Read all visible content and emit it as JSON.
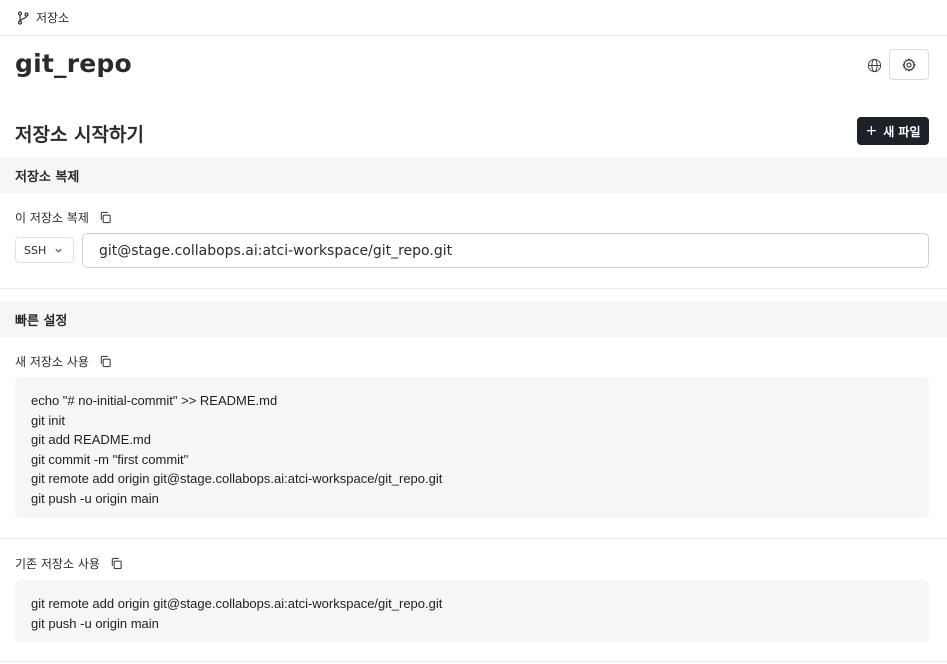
{
  "breadcrumb": {
    "label": "저장소"
  },
  "repo": {
    "name": "git_repo"
  },
  "start": {
    "heading": "저장소 시작하기",
    "new_file_label": "새 파일",
    "new_file_plus": "+"
  },
  "clone": {
    "band_title": "저장소 복제",
    "field_label": "이 저장소 복제",
    "protocol": "SSH",
    "url": "git@stage.collabops.ai:atci-workspace/git_repo.git"
  },
  "quick": {
    "band_title": "빠른 설정",
    "new_repo": {
      "label": "새 저장소 사용",
      "lines": [
        "echo \"# no-initial-commit\" >> README.md",
        "git init",
        "git add README.md",
        "git commit -m \"first commit\"",
        "git remote add origin git@stage.collabops.ai:atci-workspace/git_repo.git",
        "git push -u origin main"
      ]
    },
    "existing_repo": {
      "label": "기존 저장소 사용",
      "lines": [
        "git remote add origin git@stage.collabops.ai:atci-workspace/git_repo.git",
        "git push -u origin main"
      ]
    }
  },
  "icons": {
    "branch": "branch-icon",
    "globe": "globe-icon",
    "settings": "gear-icon",
    "copy": "copy-icon",
    "chevron": "chevron-down-icon"
  }
}
